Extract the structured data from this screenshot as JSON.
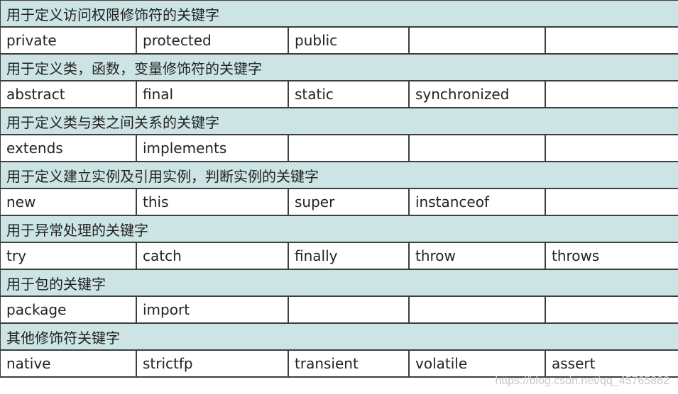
{
  "sections": [
    {
      "title": "用于定义访问权限修饰符的关键字",
      "keywords": [
        "private",
        "protected",
        "public",
        "",
        ""
      ]
    },
    {
      "title": "用于定义类，函数，变量修饰符的关键字",
      "keywords": [
        "abstract",
        "final",
        "static",
        "synchronized",
        ""
      ]
    },
    {
      "title": "用于定义类与类之间关系的关键字",
      "keywords": [
        "extends",
        "implements",
        "",
        "",
        ""
      ]
    },
    {
      "title": "用于定义建立实例及引用实例，判断实例的关键字",
      "keywords": [
        "new",
        "this",
        "super",
        "instanceof",
        ""
      ]
    },
    {
      "title": "用于异常处理的关键字",
      "keywords": [
        "try",
        "catch",
        "finally",
        "throw",
        "throws"
      ]
    },
    {
      "title": "用于包的关键字",
      "keywords": [
        "package",
        "import",
        "",
        "",
        ""
      ]
    },
    {
      "title": "其他修饰符关键字",
      "keywords": [
        "native",
        "strictfp",
        "transient",
        "volatile",
        "assert"
      ]
    }
  ],
  "watermark": "https://blog.csdn.net/qq_45765882",
  "colors": {
    "section_bg": "#cce4e4",
    "cell_bg": "#ffffff",
    "border": "#3a3f3f"
  }
}
